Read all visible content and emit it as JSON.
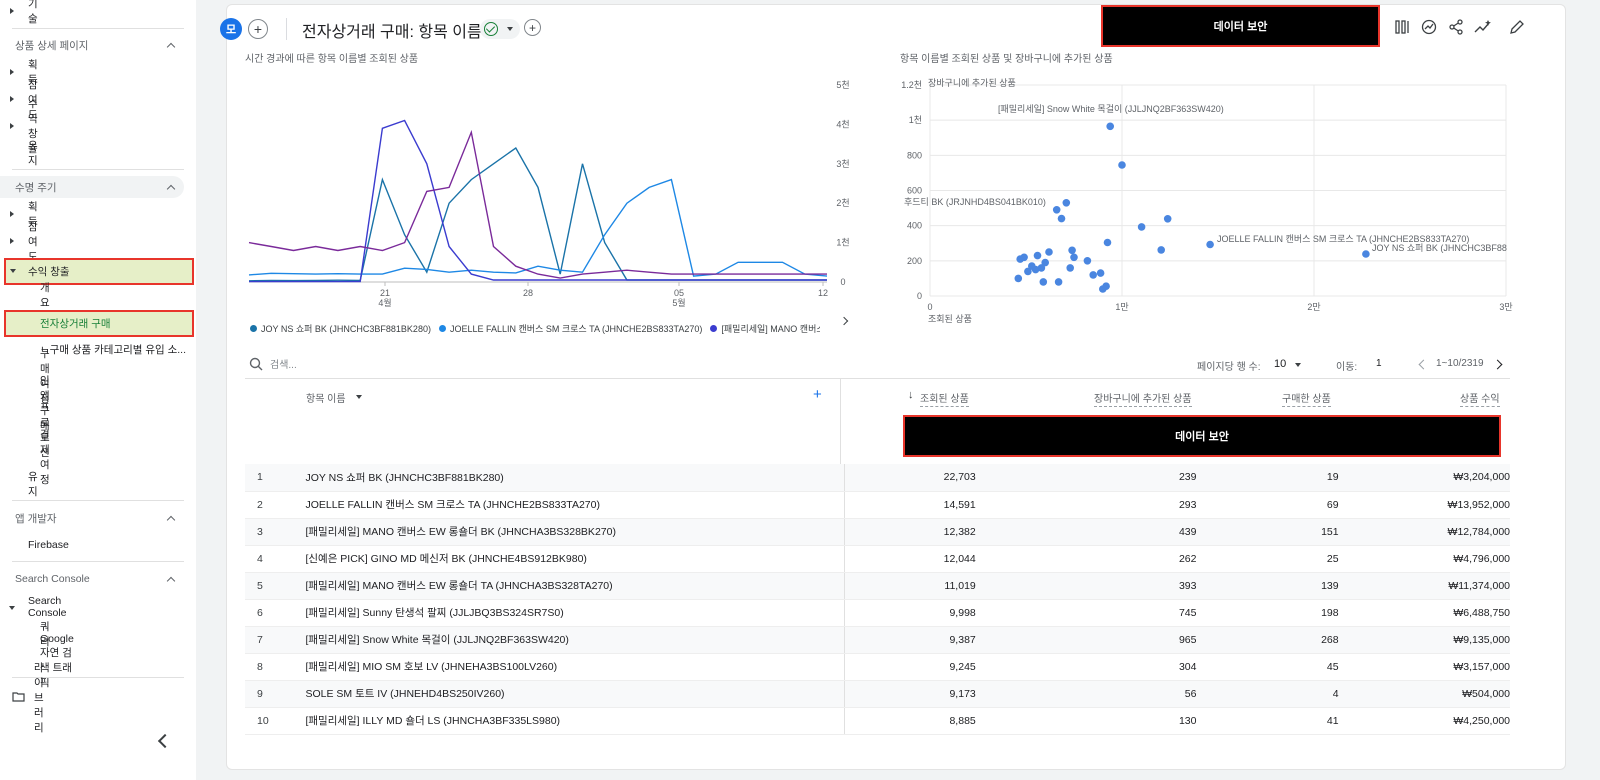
{
  "sidebar": {
    "tech": "기술",
    "sec1_title": "상품 상세 페이지",
    "sec1_items": [
      "획득",
      "참여도",
      "수익 창출",
      "유지"
    ],
    "sec2_title": "수명 주기",
    "sec2_items": [
      "획득",
      "참여도"
    ],
    "revenue": "수익 창출",
    "revenue_children": [
      "개요",
      "전자상거래 구매",
      "ㄴ구매 상품 카테고리별 유입 소...",
      "구매 여정",
      "인앱 구매",
      "프로모션",
      "결제 여정"
    ],
    "retention": "유지",
    "app_dev": "앱 개발자",
    "firebase": "Firebase",
    "sc_title": "Search Console",
    "sc_item": "Search Console",
    "sc_children": [
      "쿼리",
      "Google 자연 검색 트래픽"
    ],
    "library": "라이브러리"
  },
  "topbar": {
    "badge": "모",
    "title": "전자상거래 구매: 항목 이름",
    "redacted": "데이터 보안"
  },
  "line_chart": {
    "title": "시간 경과에 따른 항목 이름별 조회된 상품",
    "legend": [
      "JOY NS 쇼퍼 BK (JHNCHC3BF881BK280)",
      "JOELLE FALLIN 캔버스 SM 크로스 TA (JHNCHE2BS833TA270)",
      "[패밀리세일] MANO 캔버스 EW"
    ]
  },
  "scatter_chart": {
    "title": "항목 이름별 조회된 상품 및 장바구니에 추가된 상품",
    "ylabel": "장바구니에 추가된 상품",
    "xlabel": "조회된 상품",
    "labels": {
      "snow": "[패밀리세일] Snow White 목걸이 (JJLJNQ2BF363SW420)",
      "hudi": "후드티 BK (JRJNHD4BS041BK010)",
      "joelle": "JOELLE FALLIN 캔버스 SM 크로스 TA (JHNCHE2BS833TA270)",
      "joy": "JOY NS 쇼퍼 BK (JHNCHC3BF88"
    }
  },
  "chart_data": [
    {
      "type": "line",
      "title": "시간 경과에 따른 항목 이름별 조회된 상품",
      "x_ticks": [
        "21\n4월",
        "28",
        "05\n5월",
        "12"
      ],
      "y_ticks": [
        "0",
        "1천",
        "2천",
        "3천",
        "4천",
        "5천"
      ],
      "ylim": [
        0,
        5000
      ],
      "series": [
        {
          "name": "JOY NS 쇼퍼 BK (JHNCHC3BF881BK280)",
          "color": "#1a73a8",
          "values": [
            30,
            40,
            35,
            40,
            45,
            40,
            2600,
            1200,
            250,
            2000,
            2600,
            3000,
            3400,
            2400,
            200,
            3000,
            1000,
            50,
            50,
            50,
            50,
            50,
            50,
            50,
            50,
            50,
            50
          ]
        },
        {
          "name": "JOELLE FALLIN 캔버스 SM 크로스 TA (JHNCHE2BS833TA270)",
          "color": "#1e88e5",
          "values": [
            180,
            220,
            210,
            200,
            210,
            200,
            200,
            350,
            320,
            250,
            300,
            250,
            230,
            400,
            300,
            250,
            1200,
            2000,
            2400,
            2600,
            150,
            200,
            500,
            500,
            500,
            200,
            150
          ]
        },
        {
          "name": "[패밀리세일] MANO 캔버스 EW",
          "color": "#3b3ccf",
          "values": [
            10,
            10,
            10,
            10,
            10,
            10,
            3900,
            4100,
            3000,
            900,
            200,
            50,
            50,
            50,
            50,
            50,
            50,
            50,
            50,
            50,
            50,
            50,
            50,
            50,
            50,
            50,
            50
          ]
        },
        {
          "name": "",
          "color": "#7a2a9a",
          "values": [
            1000,
            900,
            800,
            900,
            800,
            900,
            800,
            1000,
            2300,
            2400,
            3800,
            900,
            400,
            200,
            100,
            200,
            250,
            300,
            250,
            200,
            200,
            200,
            200,
            200,
            200,
            200,
            200
          ]
        }
      ]
    },
    {
      "type": "scatter",
      "title": "항목 이름별 조회된 상품 및 장바구니에 추가된 상품",
      "xlabel": "조회된 상품",
      "ylabel": "장바구니에 추가된 상품",
      "xlim": [
        0,
        30000
      ],
      "ylim": [
        0,
        1200
      ],
      "x_ticks": [
        "0",
        "1만",
        "2만",
        "3만"
      ],
      "y_ticks": [
        "0",
        "200",
        "400",
        "600",
        "800",
        "1천",
        "1.2천"
      ],
      "points": [
        [
          22703,
          239
        ],
        [
          14591,
          293
        ],
        [
          12382,
          439
        ],
        [
          12044,
          262
        ],
        [
          11019,
          393
        ],
        [
          9998,
          745
        ],
        [
          9387,
          965
        ],
        [
          9245,
          304
        ],
        [
          9173,
          56
        ],
        [
          8885,
          130
        ],
        [
          7100,
          530
        ],
        [
          6850,
          440
        ],
        [
          6600,
          490
        ],
        [
          8200,
          200
        ],
        [
          8500,
          120
        ],
        [
          7500,
          220
        ],
        [
          7400,
          260
        ],
        [
          7300,
          160
        ],
        [
          6200,
          250
        ],
        [
          6000,
          190
        ],
        [
          5800,
          160
        ],
        [
          5600,
          230
        ],
        [
          5500,
          150
        ],
        [
          5300,
          170
        ],
        [
          5100,
          140
        ],
        [
          4900,
          220
        ],
        [
          4700,
          210
        ],
        [
          4600,
          100
        ],
        [
          5900,
          80
        ],
        [
          6700,
          80
        ],
        [
          9000,
          40
        ]
      ]
    }
  ],
  "table": {
    "search_placeholder": "검색...",
    "rows_per_page_label": "페이지당 행 수:",
    "rows_per_page": "10",
    "goto_label": "이동:",
    "goto_value": "1",
    "range": "1~10/2319",
    "col_name": "항목 이름",
    "col_views": "조회된 상품",
    "col_cart": "장바구니에 추가된 상품",
    "col_purchased": "구매한 상품",
    "col_revenue": "상품 수익",
    "redacted": "데이터 보안",
    "rows": [
      {
        "n": "1",
        "name": "JOY NS 쇼퍼 BK (JHNCHC3BF881BK280)",
        "views": "22,703",
        "cart": "239",
        "buy": "19",
        "rev": "₩3,204,000"
      },
      {
        "n": "2",
        "name": "JOELLE FALLIN 캔버스 SM 크로스 TA (JHNCHE2BS833TA270)",
        "views": "14,591",
        "cart": "293",
        "buy": "69",
        "rev": "₩13,952,000"
      },
      {
        "n": "3",
        "name": "[패밀리세일] MANO 캔버스 EW 롱숄더 BK (JHNCHA3BS328BK270)",
        "views": "12,382",
        "cart": "439",
        "buy": "151",
        "rev": "₩12,784,000"
      },
      {
        "n": "4",
        "name": "[신예은 PICK] GINO MD 메신저 BK (JHNCHE4BS912BK980)",
        "views": "12,044",
        "cart": "262",
        "buy": "25",
        "rev": "₩4,796,000"
      },
      {
        "n": "5",
        "name": "[패밀리세일] MANO 캔버스 EW 롱숄더 TA (JHNCHA3BS328TA270)",
        "views": "11,019",
        "cart": "393",
        "buy": "139",
        "rev": "₩11,374,000"
      },
      {
        "n": "6",
        "name": "[패밀리세일] Sunny 탄생석 팔찌 (JJLJBQ3BS324SR7S0)",
        "views": "9,998",
        "cart": "745",
        "buy": "198",
        "rev": "₩6,488,750"
      },
      {
        "n": "7",
        "name": "[패밀리세일] Snow White 목걸이 (JJLJNQ2BF363SW420)",
        "views": "9,387",
        "cart": "965",
        "buy": "268",
        "rev": "₩9,135,000"
      },
      {
        "n": "8",
        "name": "[패밀리세일] MIO SM 호보 LV (JHNEHA3BS100LV260)",
        "views": "9,245",
        "cart": "304",
        "buy": "45",
        "rev": "₩3,157,000"
      },
      {
        "n": "9",
        "name": "SOLE SM 토트 IV (JHNEHD4BS250IV260)",
        "views": "9,173",
        "cart": "56",
        "buy": "4",
        "rev": "₩504,000"
      },
      {
        "n": "10",
        "name": "[패밀리세일] ILLY MD 숄더 LS (JHNCHA3BF335LS980)",
        "views": "8,885",
        "cart": "130",
        "buy": "41",
        "rev": "₩4,250,000"
      }
    ]
  }
}
